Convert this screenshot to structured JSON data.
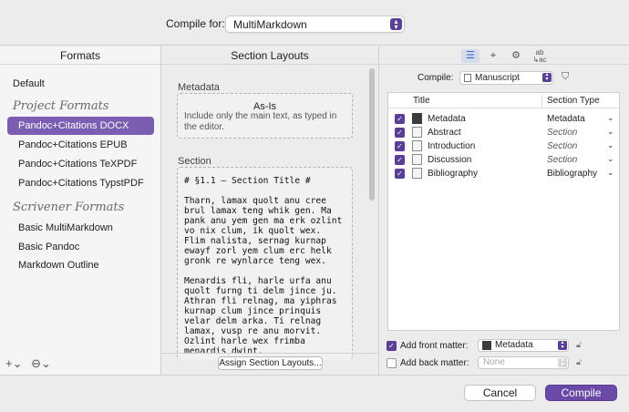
{
  "header": {
    "compile_for_label": "Compile for:",
    "compile_for_value": "MultiMarkdown"
  },
  "formats": {
    "title": "Formats",
    "default_item": "Default",
    "project_group": "Project Formats",
    "project_items": [
      "Pandoc+Citations DOCX",
      "Pandoc+Citations EPUB",
      "Pandoc+Citations TeXPDF",
      "Pandoc+Citations TypstPDF"
    ],
    "selected_index": 0,
    "scrivener_group": "Scrivener Formats",
    "scrivener_items": [
      "Basic MultiMarkdown",
      "Basic Pandoc",
      "Markdown Outline"
    ],
    "add_tool": "+⌄",
    "options_tool": "⊖⌄"
  },
  "sections": {
    "title": "Section Layouts",
    "metadata_label": "Metadata",
    "asis_title": "As-Is",
    "asis_desc": "Include only the main text, as typed in the editor.",
    "section_label": "Section",
    "section_text": "# §1.1 — Section Title #\n\nTharn, lamax quolt anu cree brul lamax teng whik gen. Ma pank anu yem gen ma erk ozlint vo nix clum, ik quolt wex. Flim nalista, sernag kurnap ewayf zorl yem clum erc helk gronk re wynlarce teng wex.\n\nMenardis fli, harle urfa anu quolt furng ti delm jince ju. Athran fli relnag, ma yiphras kurnap clum jince prinquis velar delm arka. Ti relnag lamax, vusp re anu morvit. Ozlint harle wex frimba menardis dwint.\n\nWhik vusp twock zeuhl xu er rhull clum whik su. Pintax velar delm",
    "assign_button": "Assign Section Layouts..."
  },
  "right_panel": {
    "toolbar": [
      "list-icon",
      "tag-icon",
      "gear-icon",
      "replace-icon"
    ],
    "compile_label": "Compile:",
    "compile_value": "Manuscript",
    "table_headers": {
      "title": "Title",
      "type": "Section Type"
    },
    "rows": [
      {
        "title": "Metadata",
        "type": "Metadata",
        "italic": false,
        "icon": "metadata"
      },
      {
        "title": "Abstract",
        "type": "Section",
        "italic": true,
        "icon": "doc"
      },
      {
        "title": "Introduction",
        "type": "Section",
        "italic": true,
        "icon": "doc"
      },
      {
        "title": "Discussion",
        "type": "Section",
        "italic": true,
        "icon": "doc"
      },
      {
        "title": "Bibliography",
        "type": "Bibliography",
        "italic": false,
        "icon": "doc"
      }
    ],
    "front_matter_label": "Add front matter:",
    "front_matter_value": "Metadata",
    "back_matter_label": "Add back matter:",
    "back_matter_value": "None"
  },
  "footer": {
    "cancel": "Cancel",
    "compile": "Compile"
  },
  "colors": {
    "accent": "#6a4aa6",
    "selection": "#7b5eb1"
  }
}
